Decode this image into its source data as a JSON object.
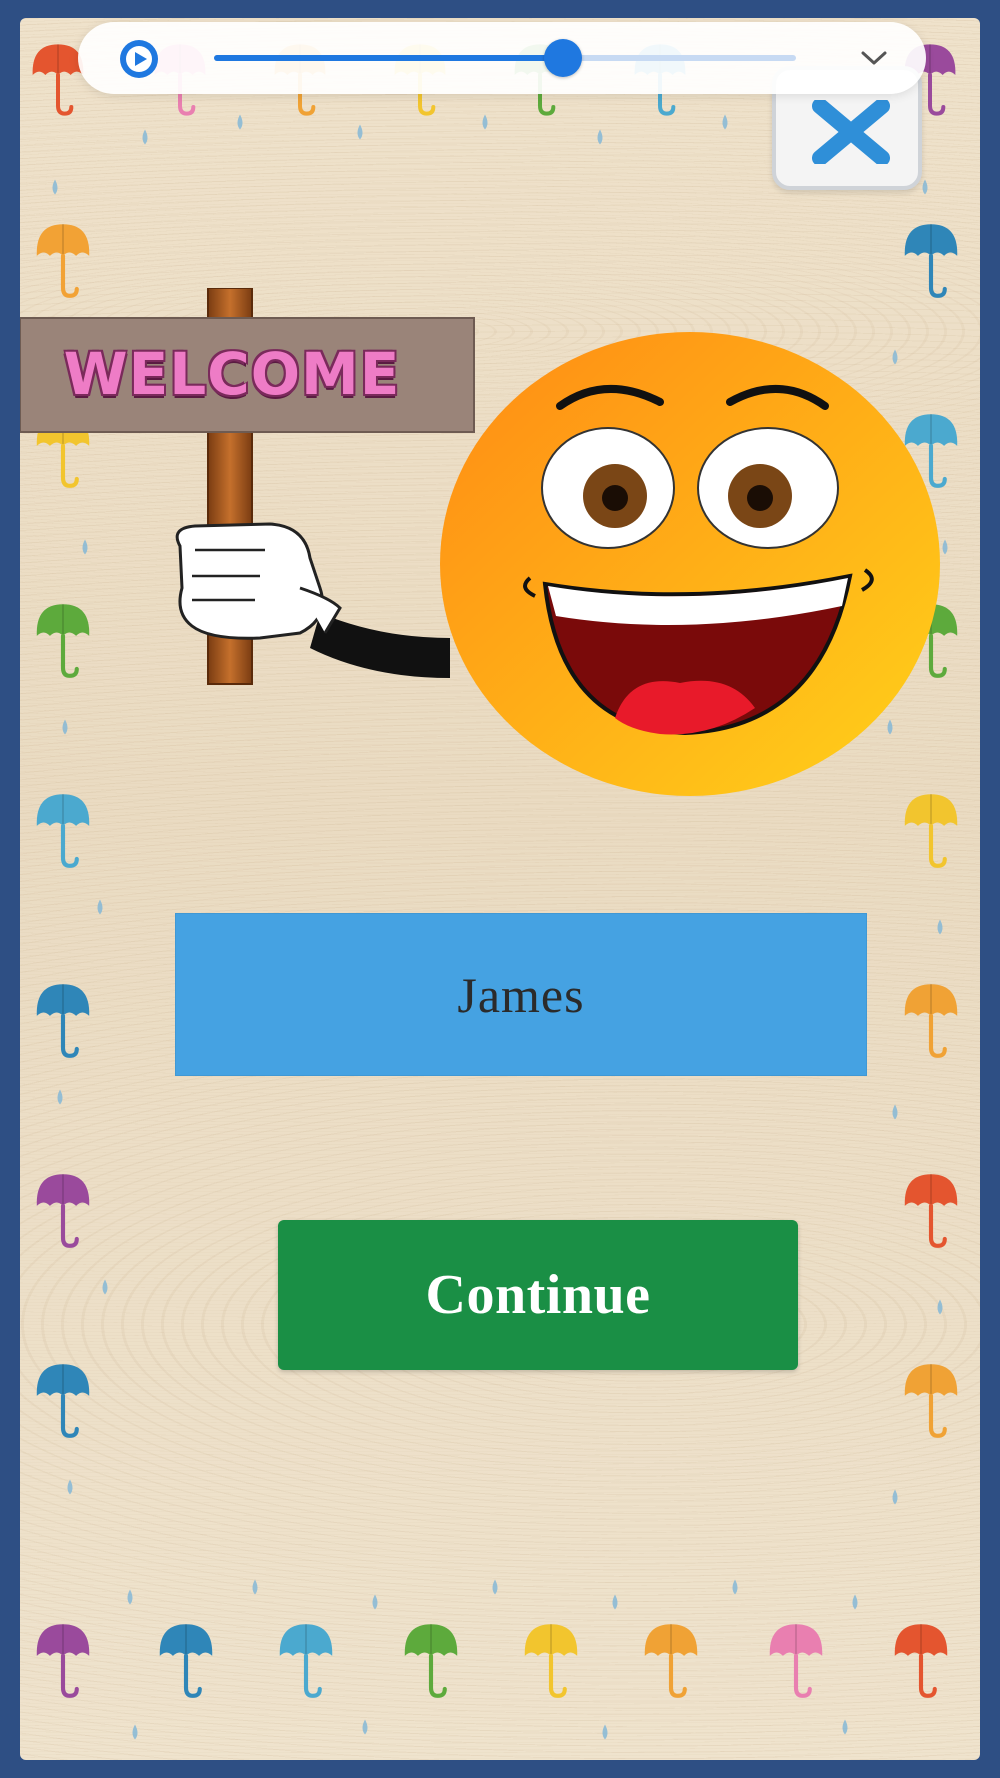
{
  "media_player": {
    "progress_fraction": 0.6,
    "play_icon": "play-icon",
    "menu_icon": "chevron-down-icon",
    "accent_color": "#1f78e0"
  },
  "close_button": {
    "icon": "close-icon"
  },
  "welcome_sign": {
    "text": "WELCOME"
  },
  "name_box": {
    "name": "James",
    "color": "#45a2e2"
  },
  "continue_button": {
    "label": "Continue",
    "color": "#1a8f45"
  }
}
